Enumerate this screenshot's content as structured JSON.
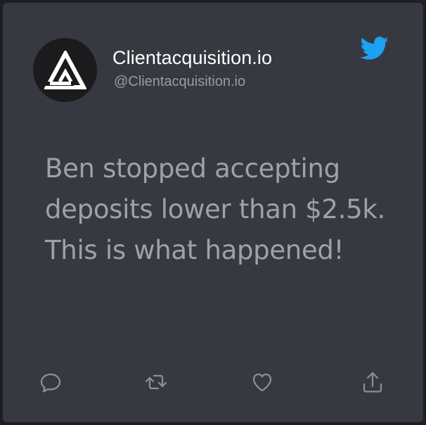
{
  "account": {
    "name": "Clientacquisition.io",
    "handle": "@Clientacquisition.io"
  },
  "tweet": {
    "text": "Ben stopped accepting deposits lower than $2.5k. This is what happened!"
  },
  "icons": {
    "avatar": "clientacquisition-logo",
    "brand": "twitter-bird-icon",
    "actions": [
      "reply-icon",
      "retweet-icon",
      "like-icon",
      "share-icon"
    ]
  },
  "colors": {
    "card_background": "#373941",
    "page_background": "#1e1f23",
    "name_text": "#ffffff",
    "handle_text": "#9a9ca3",
    "tweet_text": "#a0a1a6",
    "twitter_blue": "#1da1f2",
    "icon_color": "#8e9097"
  }
}
